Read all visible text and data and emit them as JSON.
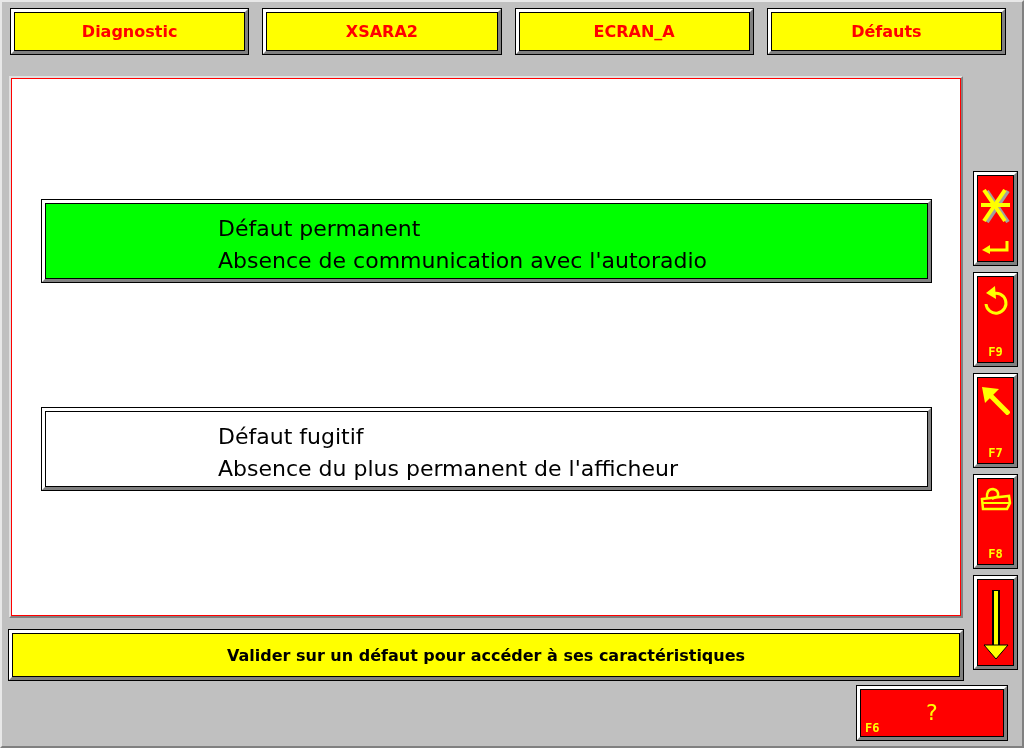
{
  "header": [
    "Diagnostic",
    "XSARA2",
    "ECRAN_A",
    "Défauts"
  ],
  "faults": [
    {
      "title": "Défaut permanent",
      "description": "Absence de communication avec l'autoradio",
      "selected": true
    },
    {
      "title": "Défaut fugitif",
      "description": "Absence du plus permanent de l'afficheur",
      "selected": false
    }
  ],
  "side_buttons": [
    {
      "kind": "exit"
    },
    {
      "kind": "undo",
      "key": "F9"
    },
    {
      "kind": "back",
      "key": "F7"
    },
    {
      "kind": "print",
      "key": "F8"
    },
    {
      "kind": "scroll_down"
    }
  ],
  "status_message": "Valider sur un défaut pour accéder à ses caractéristiques",
  "help_button": {
    "key": "F6",
    "label": "?"
  }
}
